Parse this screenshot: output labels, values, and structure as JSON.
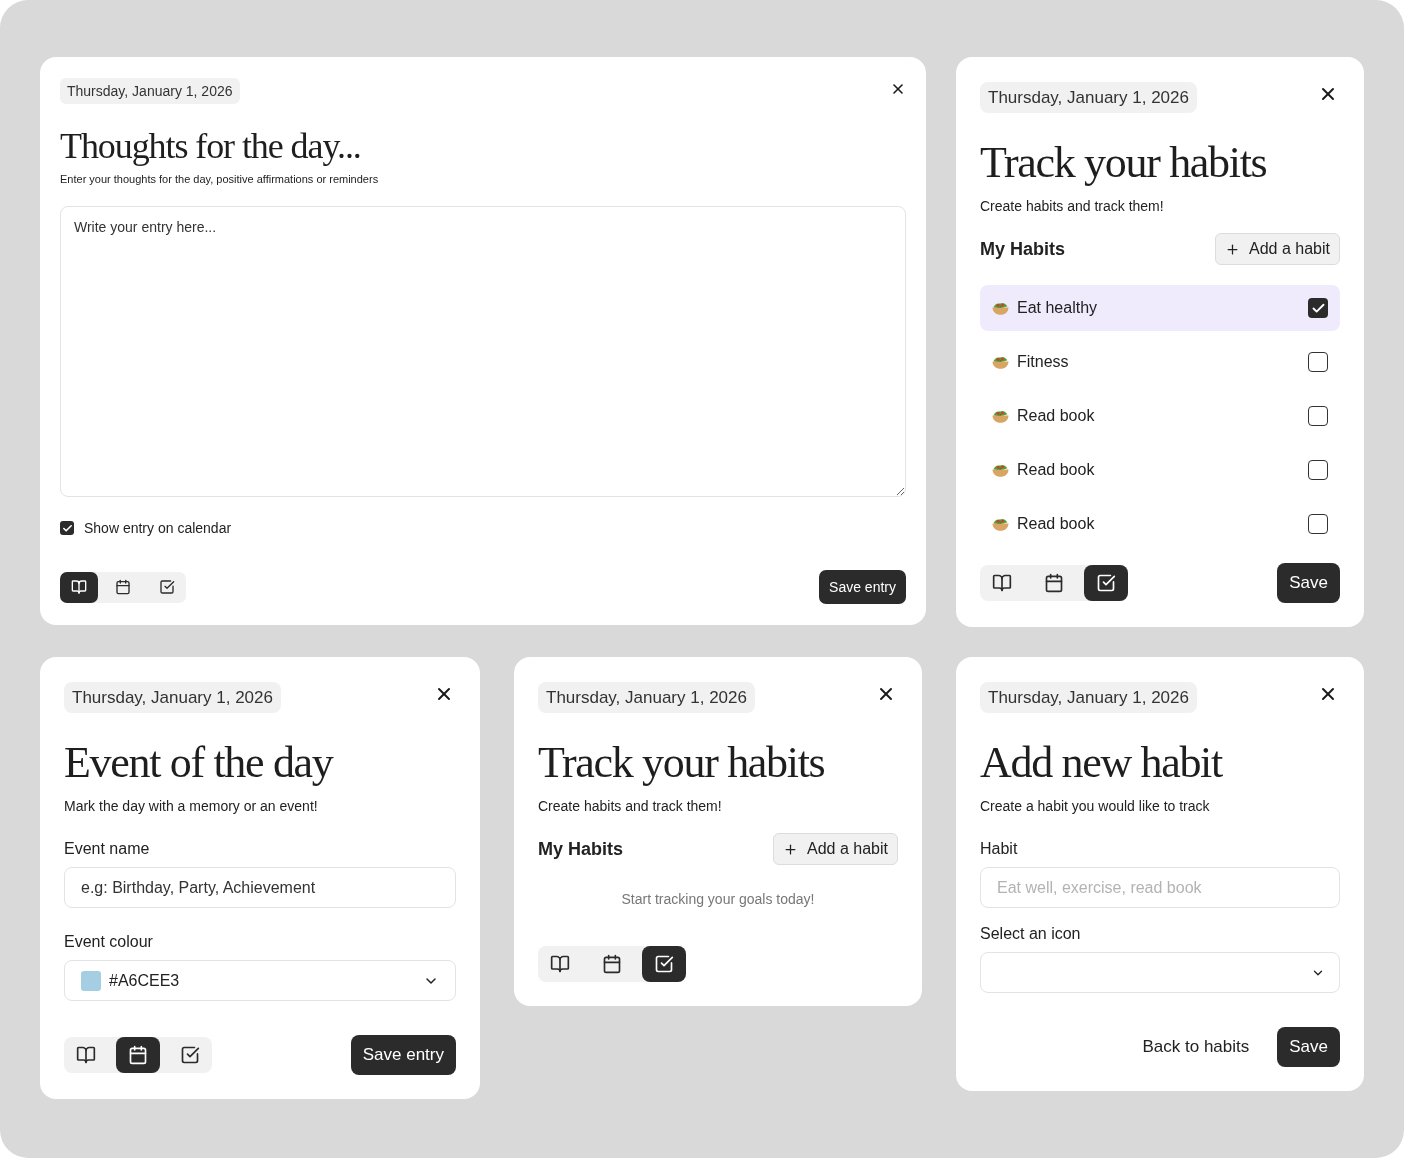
{
  "rows": [
    {
      "cards": [
        {
          "kind": "journal",
          "date": "Thursday, January 1, 2026",
          "title": "Thoughts for the day...",
          "subtitle": "Enter your thoughts for the day, positive affirmations or reminders",
          "entry": {
            "placeholder": "Write your entry here..."
          },
          "show_on_calendar": {
            "label": "Show entry on calendar",
            "checked": true
          },
          "tabs": [
            {
              "kind": "journal",
              "selected": true
            },
            {
              "kind": "event",
              "selected": false
            },
            {
              "kind": "habits",
              "selected": false
            }
          ],
          "save_button": "Save entry"
        },
        {
          "kind": "habits",
          "date": "Thursday, January 1, 2026",
          "title": "Track your habits",
          "subtitle": "Create habits and track them!",
          "section_title": "My Habits",
          "add_button": "Add a habit",
          "habits": [
            {
              "label": "Eat healthy",
              "checked": true
            },
            {
              "label": "Fitness",
              "checked": false
            },
            {
              "label": "Read book",
              "checked": false
            },
            {
              "label": "Read book",
              "checked": false
            },
            {
              "label": "Read book",
              "checked": false
            }
          ],
          "tabs": [
            {
              "kind": "journal",
              "selected": false
            },
            {
              "kind": "event",
              "selected": false
            },
            {
              "kind": "habits",
              "selected": true
            }
          ],
          "save_button": "Save"
        }
      ]
    },
    {
      "cards": [
        {
          "kind": "event",
          "date": "Thursday, January 1, 2026",
          "title": "Event of the day",
          "subtitle": "Mark the day with a memory or an event!",
          "event_name": {
            "label": "Event name",
            "placeholder": "e.g: Birthday, Party, Achievement"
          },
          "event_colour": {
            "label": "Event colour",
            "value": "#A6CEE3",
            "color": "#a6cee3"
          },
          "tabs": [
            {
              "kind": "journal",
              "selected": false
            },
            {
              "kind": "event",
              "selected": true
            },
            {
              "kind": "habits",
              "selected": false
            }
          ],
          "save_button": "Save entry"
        },
        {
          "kind": "habits",
          "date": "Thursday, January 1, 2026",
          "title": "Track your habits",
          "subtitle": "Create habits and track them!",
          "section_title": "My Habits",
          "add_button": "Add a habit",
          "empty_message": "Start tracking your goals today!",
          "tabs": [
            {
              "kind": "journal",
              "selected": false
            },
            {
              "kind": "event",
              "selected": false
            },
            {
              "kind": "habits",
              "selected": true
            }
          ]
        },
        {
          "kind": "add_habit",
          "date": "Thursday, January 1, 2026",
          "title": "Add new habit",
          "subtitle": "Create a habit you would like to track",
          "habit": {
            "label": "Habit",
            "placeholder": "Eat well, exercise, read book"
          },
          "icon_select": {
            "label": "Select an icon"
          },
          "back_button": "Back to habits",
          "save_button": "Save"
        }
      ]
    }
  ]
}
